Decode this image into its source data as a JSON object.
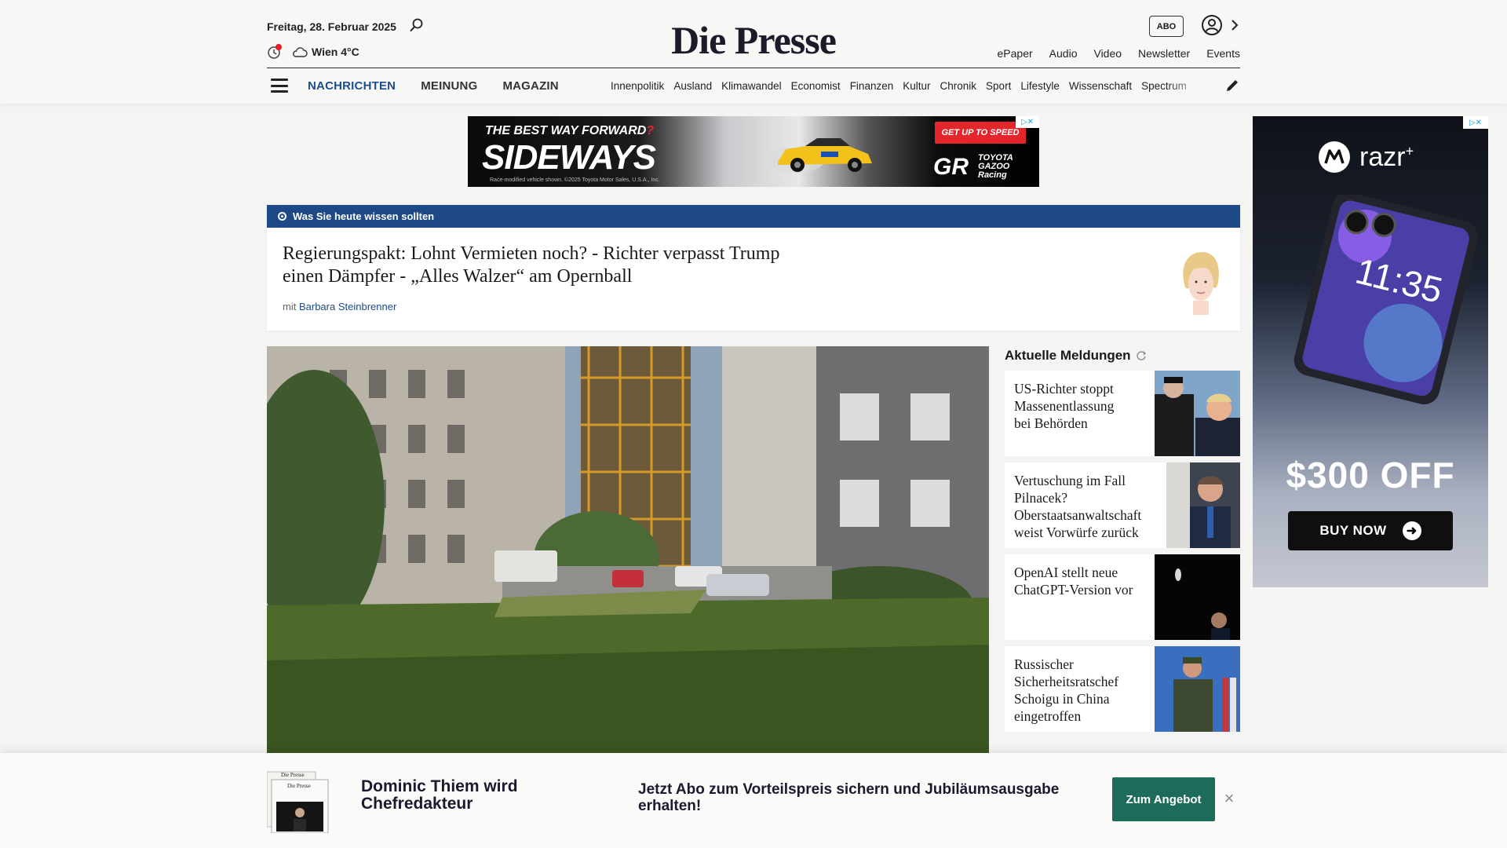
{
  "header": {
    "date": "Freitag, 28. Februar 2025",
    "weather": "Wien 4°C",
    "logo": "Die Presse",
    "abo_label": "ABO",
    "top_links": [
      "ePaper",
      "Audio",
      "Video",
      "Newsletter",
      "Events"
    ],
    "main_nav": [
      "NACHRICHTEN",
      "MEINUNG",
      "MAGAZIN"
    ],
    "sub_nav": [
      "Innenpolitik",
      "Ausland",
      "Klimawandel",
      "Economist",
      "Finanzen",
      "Kultur",
      "Chronik",
      "Sport",
      "Lifestyle",
      "Wissenschaft",
      "Spectrum"
    ]
  },
  "ad_banner": {
    "line1": "THE BEST WAY FORWARD",
    "line1_mark": "?",
    "line2": "SIDEWAYS",
    "fine_print": "Race-modified vehicle shown. ©2025 Toyota Motor Sales, U.S.A., Inc.",
    "cta": "GET UP TO SPEED",
    "brand_mark": "GR",
    "brand_text": "TOYOTA GAZOO Racing"
  },
  "briefing": {
    "label": "Was Sie heute wissen sollten",
    "title": "Regierungspakt: Lohnt Vermieten noch? - Richter verpasst Trump einen Dämpfer - „Alles Walzer“ am Opernball",
    "by_prefix": "mit",
    "author": "Barbara Steinbrenner"
  },
  "aktuell": {
    "heading": "Aktuelle Meldungen",
    "items": [
      {
        "title": "US-Richter stoppt Massenentlassung bei Behörden"
      },
      {
        "title": "Vertuschung im Fall Pilnacek? Oberstaatsanwaltschaft weist Vorwürfe zurück"
      },
      {
        "title": "OpenAI stellt neue ChatGPT-Version vor"
      },
      {
        "title": "Russischer Sicherheitsratschef Schoigu in China eingetroffen"
      }
    ]
  },
  "side_ad": {
    "brand": "razr",
    "brand_sup": "+",
    "phone_time": "11:35",
    "offer": "$300 OFF",
    "cta": "BUY NOW"
  },
  "promo": {
    "headline": "Dominic Thiem wird Chefredakteur",
    "text": "Jetzt Abo zum Vorteilspreis sichern und Jubiläumsausgabe erhalten!",
    "button": "Zum Angebot",
    "close": "×"
  },
  "colors": {
    "brand_blue": "#1d4a86",
    "promo_green": "#1d6b5a",
    "ad_red": "#e3262c"
  }
}
